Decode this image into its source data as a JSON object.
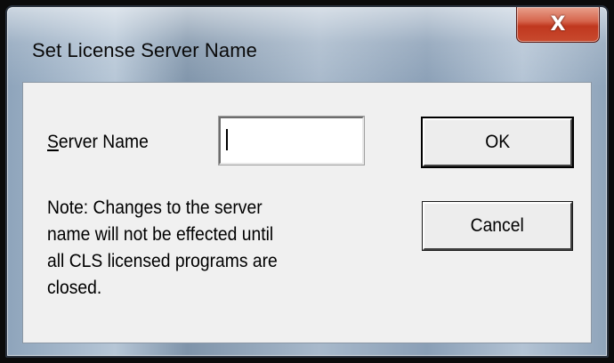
{
  "dialog": {
    "title": "Set License Server Name",
    "close_label": "X"
  },
  "form": {
    "server_label_accel": "S",
    "server_label_rest": "erver Name",
    "server_value": ""
  },
  "buttons": {
    "ok_label": "OK",
    "cancel_label": "Cancel"
  },
  "note": {
    "text": "Note: Changes to the server\nname will not be effected until\nall CLS licensed programs are\nclosed."
  }
}
